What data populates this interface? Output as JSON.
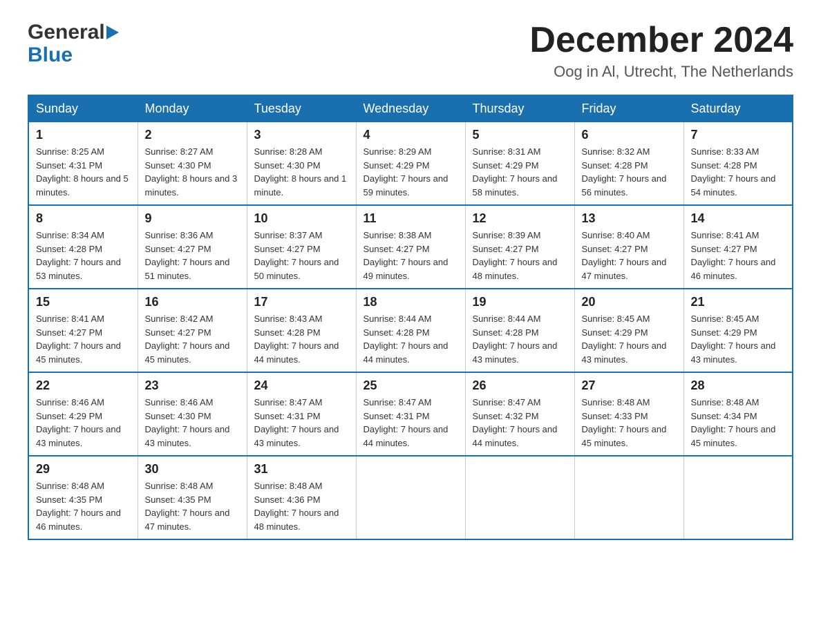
{
  "header": {
    "logo_general": "General",
    "logo_blue": "Blue",
    "month_title": "December 2024",
    "subtitle": "Oog in Al, Utrecht, The Netherlands"
  },
  "days_of_week": [
    "Sunday",
    "Monday",
    "Tuesday",
    "Wednesday",
    "Thursday",
    "Friday",
    "Saturday"
  ],
  "weeks": [
    [
      {
        "day": "1",
        "sunrise": "8:25 AM",
        "sunset": "4:31 PM",
        "daylight": "8 hours and 5 minutes."
      },
      {
        "day": "2",
        "sunrise": "8:27 AM",
        "sunset": "4:30 PM",
        "daylight": "8 hours and 3 minutes."
      },
      {
        "day": "3",
        "sunrise": "8:28 AM",
        "sunset": "4:30 PM",
        "daylight": "8 hours and 1 minute."
      },
      {
        "day": "4",
        "sunrise": "8:29 AM",
        "sunset": "4:29 PM",
        "daylight": "7 hours and 59 minutes."
      },
      {
        "day": "5",
        "sunrise": "8:31 AM",
        "sunset": "4:29 PM",
        "daylight": "7 hours and 58 minutes."
      },
      {
        "day": "6",
        "sunrise": "8:32 AM",
        "sunset": "4:28 PM",
        "daylight": "7 hours and 56 minutes."
      },
      {
        "day": "7",
        "sunrise": "8:33 AM",
        "sunset": "4:28 PM",
        "daylight": "7 hours and 54 minutes."
      }
    ],
    [
      {
        "day": "8",
        "sunrise": "8:34 AM",
        "sunset": "4:28 PM",
        "daylight": "7 hours and 53 minutes."
      },
      {
        "day": "9",
        "sunrise": "8:36 AM",
        "sunset": "4:27 PM",
        "daylight": "7 hours and 51 minutes."
      },
      {
        "day": "10",
        "sunrise": "8:37 AM",
        "sunset": "4:27 PM",
        "daylight": "7 hours and 50 minutes."
      },
      {
        "day": "11",
        "sunrise": "8:38 AM",
        "sunset": "4:27 PM",
        "daylight": "7 hours and 49 minutes."
      },
      {
        "day": "12",
        "sunrise": "8:39 AM",
        "sunset": "4:27 PM",
        "daylight": "7 hours and 48 minutes."
      },
      {
        "day": "13",
        "sunrise": "8:40 AM",
        "sunset": "4:27 PM",
        "daylight": "7 hours and 47 minutes."
      },
      {
        "day": "14",
        "sunrise": "8:41 AM",
        "sunset": "4:27 PM",
        "daylight": "7 hours and 46 minutes."
      }
    ],
    [
      {
        "day": "15",
        "sunrise": "8:41 AM",
        "sunset": "4:27 PM",
        "daylight": "7 hours and 45 minutes."
      },
      {
        "day": "16",
        "sunrise": "8:42 AM",
        "sunset": "4:27 PM",
        "daylight": "7 hours and 45 minutes."
      },
      {
        "day": "17",
        "sunrise": "8:43 AM",
        "sunset": "4:28 PM",
        "daylight": "7 hours and 44 minutes."
      },
      {
        "day": "18",
        "sunrise": "8:44 AM",
        "sunset": "4:28 PM",
        "daylight": "7 hours and 44 minutes."
      },
      {
        "day": "19",
        "sunrise": "8:44 AM",
        "sunset": "4:28 PM",
        "daylight": "7 hours and 43 minutes."
      },
      {
        "day": "20",
        "sunrise": "8:45 AM",
        "sunset": "4:29 PM",
        "daylight": "7 hours and 43 minutes."
      },
      {
        "day": "21",
        "sunrise": "8:45 AM",
        "sunset": "4:29 PM",
        "daylight": "7 hours and 43 minutes."
      }
    ],
    [
      {
        "day": "22",
        "sunrise": "8:46 AM",
        "sunset": "4:29 PM",
        "daylight": "7 hours and 43 minutes."
      },
      {
        "day": "23",
        "sunrise": "8:46 AM",
        "sunset": "4:30 PM",
        "daylight": "7 hours and 43 minutes."
      },
      {
        "day": "24",
        "sunrise": "8:47 AM",
        "sunset": "4:31 PM",
        "daylight": "7 hours and 43 minutes."
      },
      {
        "day": "25",
        "sunrise": "8:47 AM",
        "sunset": "4:31 PM",
        "daylight": "7 hours and 44 minutes."
      },
      {
        "day": "26",
        "sunrise": "8:47 AM",
        "sunset": "4:32 PM",
        "daylight": "7 hours and 44 minutes."
      },
      {
        "day": "27",
        "sunrise": "8:48 AM",
        "sunset": "4:33 PM",
        "daylight": "7 hours and 45 minutes."
      },
      {
        "day": "28",
        "sunrise": "8:48 AM",
        "sunset": "4:34 PM",
        "daylight": "7 hours and 45 minutes."
      }
    ],
    [
      {
        "day": "29",
        "sunrise": "8:48 AM",
        "sunset": "4:35 PM",
        "daylight": "7 hours and 46 minutes."
      },
      {
        "day": "30",
        "sunrise": "8:48 AM",
        "sunset": "4:35 PM",
        "daylight": "7 hours and 47 minutes."
      },
      {
        "day": "31",
        "sunrise": "8:48 AM",
        "sunset": "4:36 PM",
        "daylight": "7 hours and 48 minutes."
      },
      null,
      null,
      null,
      null
    ]
  ],
  "labels": {
    "sunrise": "Sunrise: ",
    "sunset": "Sunset: ",
    "daylight": "Daylight: "
  }
}
